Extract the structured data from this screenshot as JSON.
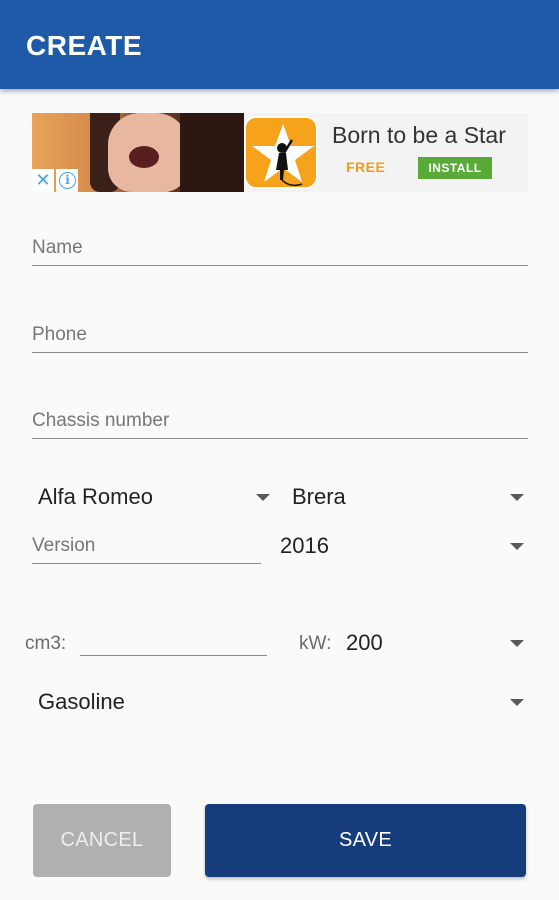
{
  "appbar": {
    "title": "CREATE"
  },
  "ad": {
    "close_glyph": "✕",
    "info_glyph": "i",
    "headline": "Born to be a Star",
    "price": "FREE",
    "install_label": "INSTALL",
    "icon": "star-singer-icon"
  },
  "form": {
    "name_placeholder": "Name",
    "phone_placeholder": "Phone",
    "chassis_placeholder": "Chassis number",
    "make_value": "Alfa Romeo",
    "model_value": "Brera",
    "version_placeholder": "Version",
    "year_value": "2016",
    "cm3_label": "cm3:",
    "kw_label": "kW:",
    "kw_value": "200",
    "fuel_value": "Gasoline"
  },
  "buttons": {
    "cancel_label": "CANCEL",
    "save_label": "SAVE"
  },
  "colors": {
    "appbar": "#1e5aa8",
    "save": "#163c7c",
    "cancel": "#b0b0b0",
    "install": "#5aaa3a",
    "free": "#f39c12"
  }
}
